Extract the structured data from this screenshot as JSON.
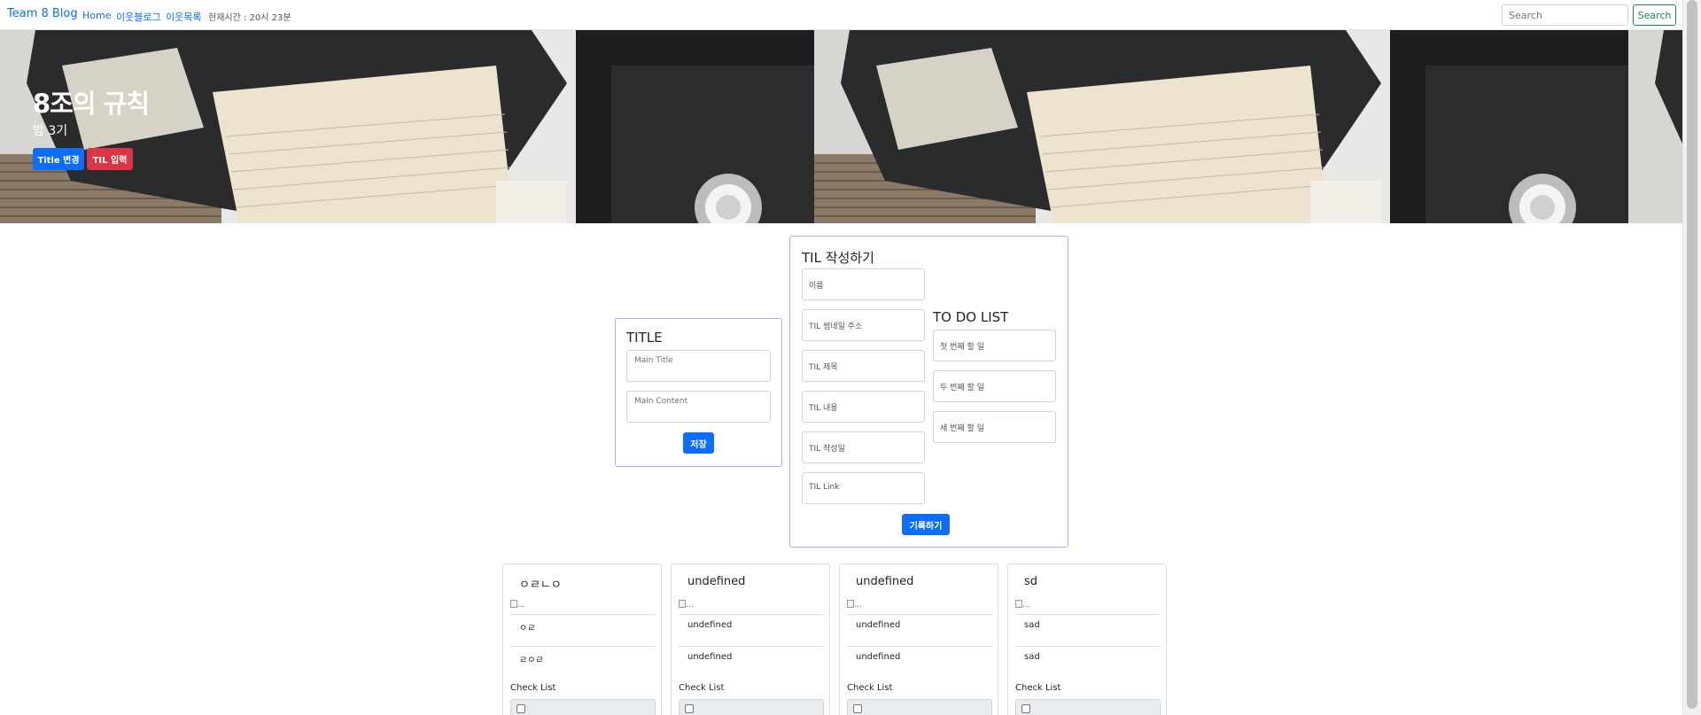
{
  "navbar": {
    "brand": "Team 8 Blog",
    "links": [
      "Home",
      "이웃블로그",
      "이웃목록"
    ],
    "time_text": "현재시간 : 20시 23분",
    "search_placeholder": "Search",
    "search_button": "Search"
  },
  "hero": {
    "title": "8조의 규칙",
    "subtitle": "밤 3기",
    "buttons": [
      "Title 변경",
      "TIL 입력"
    ],
    "colors": {
      "blue": "#0d6efd",
      "red": "#dc3545"
    }
  },
  "title_card": {
    "heading": "TITLE",
    "main_title_placeholder": "Main Title",
    "main_content_placeholder": "Main Content",
    "save_button": "저장"
  },
  "til_card": {
    "heading": "TIL 작성하기",
    "fields": [
      "이름",
      "TIL 썸네일 주소",
      "TIL 제목",
      "TIL 내용",
      "TIL 작성일",
      "TIL Link"
    ],
    "todo_heading": "TO DO LIST",
    "todos": [
      "첫 번째 할 일",
      "두 번째 할 일",
      "세 번째 할 일"
    ],
    "submit_button": "기록하기"
  },
  "posts": [
    {
      "title": "ㅇㄹㄴㅇ",
      "img_alt": "...",
      "line1": "ㅇㄹ",
      "line2": "ㄹㅇㄹ",
      "check_label": "Check List"
    },
    {
      "title": "undefined",
      "img_alt": "...",
      "line1": "undefined",
      "line2": "undefined",
      "check_label": "Check List"
    },
    {
      "title": "undefined",
      "img_alt": "...",
      "line1": "undefined",
      "line2": "undefined",
      "check_label": "Check List"
    },
    {
      "title": "sd",
      "img_alt": "...",
      "line1": "sad",
      "line2": "sad",
      "check_label": "Check List"
    }
  ]
}
